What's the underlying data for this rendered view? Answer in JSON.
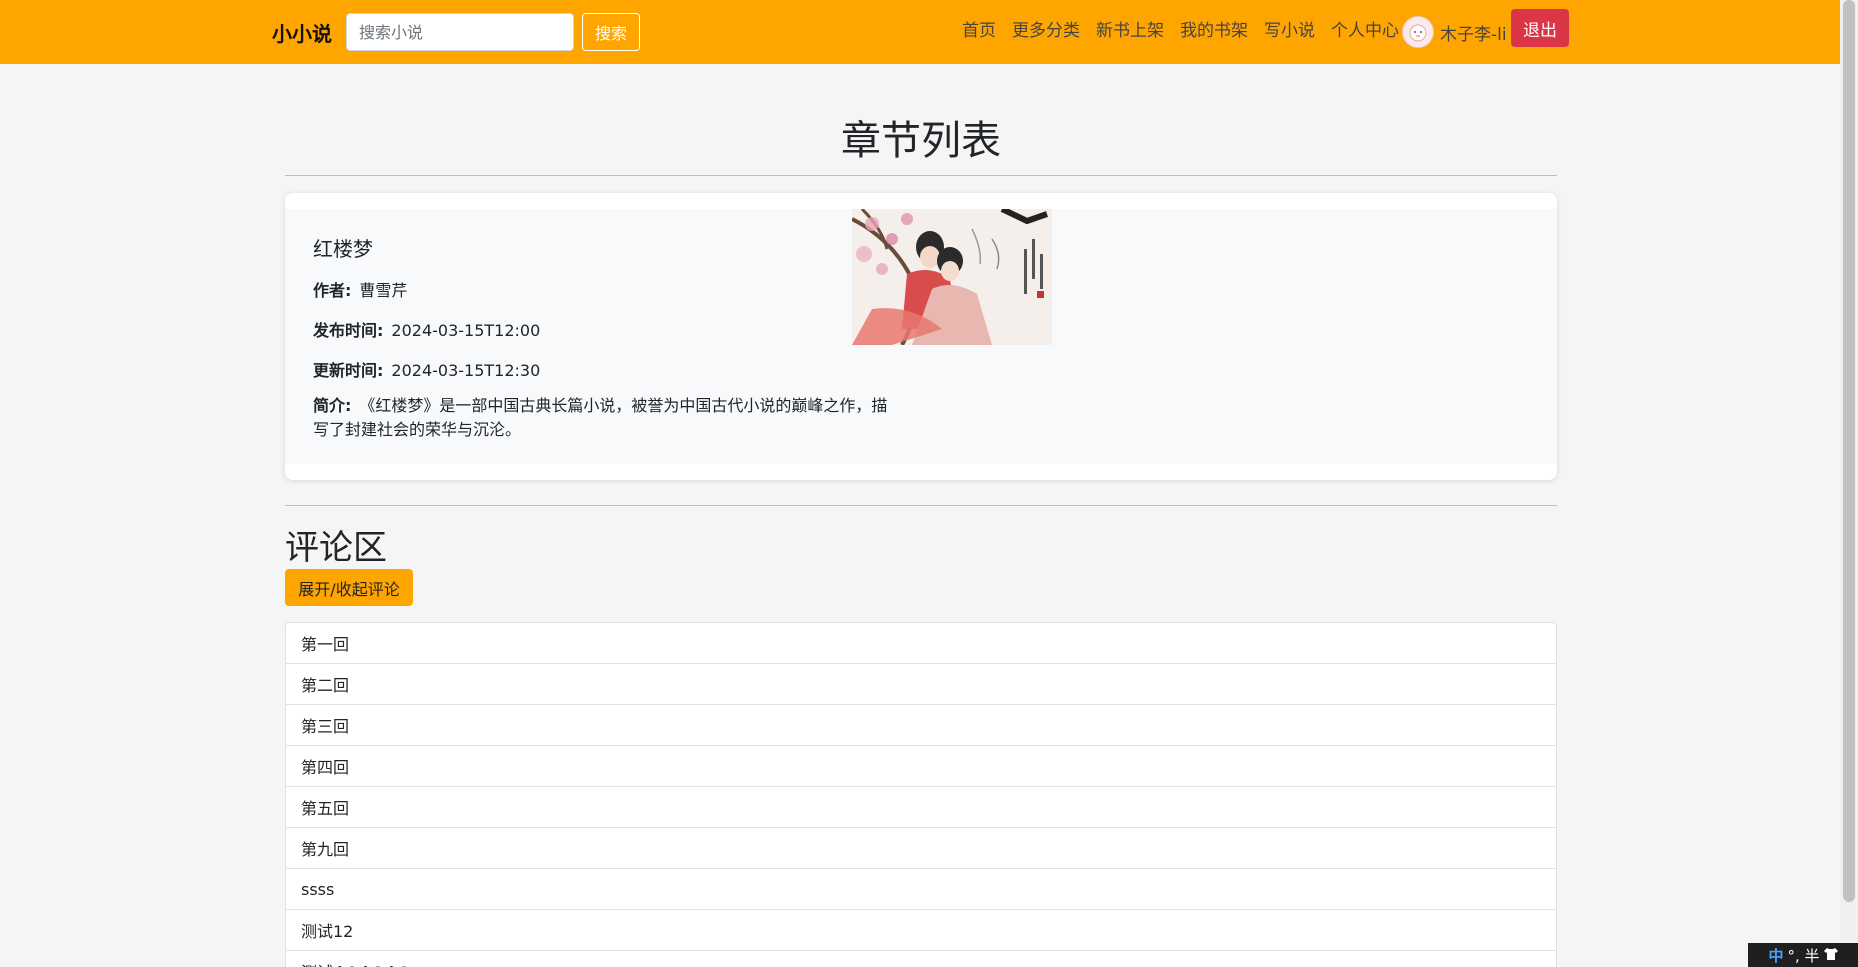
{
  "navbar": {
    "brand": "小小说",
    "search_placeholder": "搜索小说",
    "search_button": "搜索",
    "links": [
      "首页",
      "更多分类",
      "新书上架",
      "我的书架",
      "写小说",
      "个人中心"
    ],
    "user_name": "木子李-li",
    "logout": "退出"
  },
  "page": {
    "title": "章节列表"
  },
  "book": {
    "title": "红楼梦",
    "author_label": "作者:",
    "author": "曹雪芹",
    "published_label": "发布时间:",
    "published": "2024-03-15T12:00",
    "updated_label": "更新时间:",
    "updated": "2024-03-15T12:30",
    "intro_label": "简介:",
    "intro": "《红楼梦》是一部中国古典长篇小说，被誉为中国古代小说的巅峰之作，描写了封建社会的荣华与沉沦。"
  },
  "comments": {
    "title": "评论区",
    "toggle_button": "展开/收起评论"
  },
  "chapters": [
    "第一回",
    "第二回",
    "第三回",
    "第四回",
    "第五回",
    "第九回",
    "ssss",
    "测试12",
    "测试^&^&^&"
  ],
  "ime": {
    "zh": "中",
    "rest": "°, 半"
  },
  "colors": {
    "navbar": "#ffa500",
    "logout": "#dc3545",
    "toggle": "#ffa500"
  }
}
